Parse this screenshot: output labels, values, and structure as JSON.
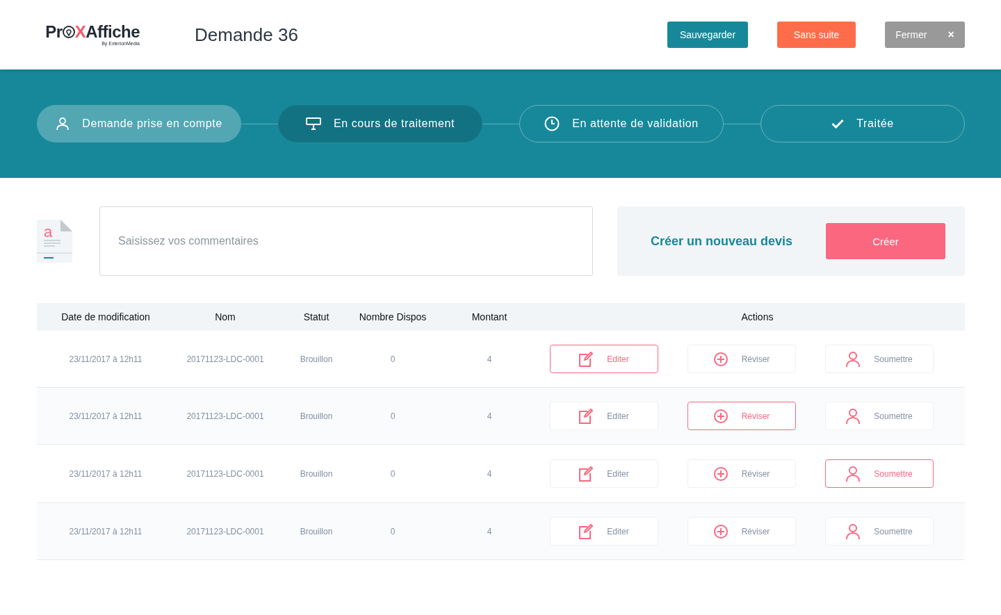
{
  "header": {
    "logo": {
      "before": "Pr",
      "mark": "X",
      "after": "Affiche",
      "tagline": "By ExterionMedia"
    },
    "title": "Demande 36",
    "buttons": [
      {
        "kind": "save",
        "label": "Sauvegarder"
      },
      {
        "kind": "dismiss",
        "label": "Sans suite"
      },
      {
        "kind": "close",
        "label": "Fermer",
        "icon": "×"
      }
    ]
  },
  "steps": [
    {
      "label": "Demande prise en compte",
      "done": true,
      "selected": false
    },
    {
      "label": "En cours de traitement",
      "done": false,
      "selected": true
    },
    {
      "label": "En attente de validation",
      "done": false,
      "selected": false
    },
    {
      "label": "Traitée",
      "done": false,
      "selected": false
    }
  ],
  "comment": {
    "placeholder": "Saisissez vos commentaires",
    "doc_letter": "a"
  },
  "new_quote": {
    "label": "Créer un nouveau devis",
    "button": "Créer"
  },
  "table": {
    "columns": [
      "Date de modification",
      "Nom",
      "Statut",
      "Nombre Dispos",
      "Montant",
      "Actions"
    ],
    "rows": [
      {
        "date": "23/11/2017 à 12h11",
        "name": "20171123-LDC-0001",
        "status": "Brouillon",
        "dispos": "0",
        "amount": "4",
        "actions": [
          {
            "kind": "edit",
            "label": "Editer",
            "selected": true
          },
          {
            "kind": "revise",
            "label": "Réviser",
            "selected": false
          },
          {
            "kind": "submit",
            "label": "Soumettre",
            "selected": false
          }
        ]
      },
      {
        "date": "23/11/2017 à 12h11",
        "name": "20171123-LDC-0001",
        "status": "Brouillon",
        "dispos": "0",
        "amount": "4",
        "actions": [
          {
            "kind": "edit",
            "label": "Editer",
            "selected": false
          },
          {
            "kind": "revise",
            "label": "Réviser",
            "selected": true
          },
          {
            "kind": "submit",
            "label": "Soumettre",
            "selected": false
          }
        ]
      },
      {
        "date": "23/11/2017 à 12h11",
        "name": "20171123-LDC-0001",
        "status": "Brouillon",
        "dispos": "0",
        "amount": "4",
        "actions": [
          {
            "kind": "edit",
            "label": "Editer",
            "selected": false
          },
          {
            "kind": "revise",
            "label": "Réviser",
            "selected": false
          },
          {
            "kind": "submit",
            "label": "Soumettre",
            "selected": true
          }
        ]
      },
      {
        "date": "23/11/2017 à 12h11",
        "name": "20171123-LDC-0001",
        "status": "Brouillon",
        "dispos": "0",
        "amount": "4",
        "actions": [
          {
            "kind": "edit",
            "label": "Editer",
            "selected": false
          },
          {
            "kind": "revise",
            "label": "Réviser",
            "selected": false
          },
          {
            "kind": "submit",
            "label": "Soumettre",
            "selected": false
          }
        ]
      }
    ]
  }
}
